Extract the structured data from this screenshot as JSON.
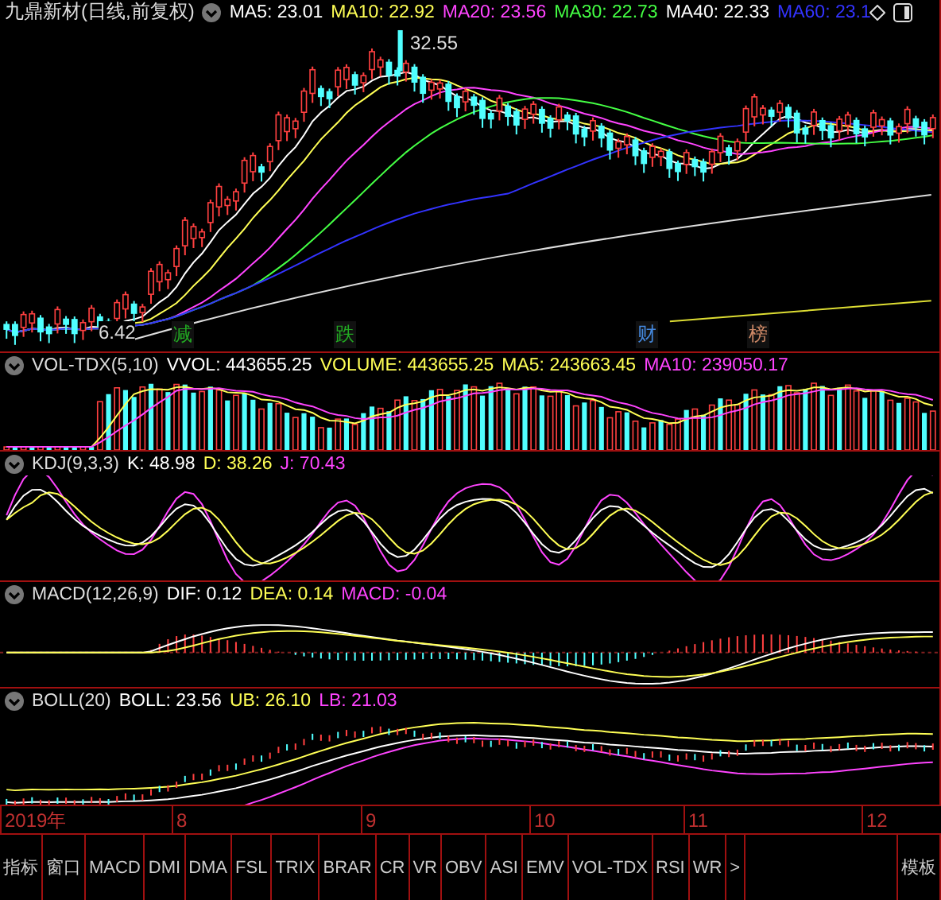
{
  "main_chart": {
    "title": "九鼎新材(日线,前复权)",
    "indicators": [
      {
        "text": "MA5: 23.01",
        "color": "#ffffff"
      },
      {
        "text": "MA10: 22.92",
        "color": "#ffff55"
      },
      {
        "text": "MA20: 23.56",
        "color": "#ff44ff"
      },
      {
        "text": "MA30: 22.73",
        "color": "#44ff44"
      },
      {
        "text": "MA40: 22.33",
        "color": "#ffffff"
      },
      {
        "text": "MA60: 23.1",
        "color": "#3333ff"
      }
    ],
    "high_label": "32.55",
    "low_label": "6.42",
    "markers": [
      {
        "text": "减",
        "color": "#22aa22"
      },
      {
        "text": "跌",
        "color": "#22aa22"
      },
      {
        "text": "财",
        "color": "#4488dd"
      },
      {
        "text": "榜",
        "color": "#cc8866"
      }
    ]
  },
  "panes": [
    {
      "kind": "volume",
      "title": "VOL-TDX(5,10)",
      "values": [
        {
          "text": "VVOL: 443655.25",
          "color": "#ffffff"
        },
        {
          "text": "VOLUME: 443655.25",
          "color": "#ffff55"
        },
        {
          "text": "MA5: 243663.45",
          "color": "#ffff55"
        },
        {
          "text": "MA10: 239050.17",
          "color": "#ff44ff"
        }
      ]
    },
    {
      "kind": "kdj",
      "title": "KDJ(9,3,3)",
      "values": [
        {
          "text": "K: 48.98",
          "color": "#ffffff"
        },
        {
          "text": "D: 38.26",
          "color": "#ffff55"
        },
        {
          "text": "J: 70.43",
          "color": "#ff44ff"
        }
      ]
    },
    {
      "kind": "macd",
      "title": "MACD(12,26,9)",
      "values": [
        {
          "text": "DIF: 0.12",
          "color": "#ffffff"
        },
        {
          "text": "DEA: 0.14",
          "color": "#ffff55"
        },
        {
          "text": "MACD: -0.04",
          "color": "#ff44ff"
        }
      ]
    },
    {
      "kind": "boll",
      "title": "BOLL(20)",
      "values": [
        {
          "text": "BOLL: 23.56",
          "color": "#ffffff"
        },
        {
          "text": "UB: 26.10",
          "color": "#ffff55"
        },
        {
          "text": "LB: 21.03",
          "color": "#ff44ff"
        }
      ]
    }
  ],
  "time_axis": [
    "2019年",
    "8",
    "9",
    "10",
    "11",
    "12"
  ],
  "tabs": [
    {
      "label": "指标",
      "selected": false
    },
    {
      "label": "窗口",
      "selected": false
    },
    {
      "label": "MACD",
      "selected": false
    },
    {
      "label": "DMI",
      "selected": false
    },
    {
      "label": "DMA",
      "selected": false
    },
    {
      "label": "FSL",
      "selected": false
    },
    {
      "label": "TRIX",
      "selected": false
    },
    {
      "label": "BRAR",
      "selected": false
    },
    {
      "label": "CR",
      "selected": false
    },
    {
      "label": "VR",
      "selected": false
    },
    {
      "label": "OBV",
      "selected": false
    },
    {
      "label": "ASI",
      "selected": false
    },
    {
      "label": "EMV",
      "selected": false
    },
    {
      "label": "VOL-TDX",
      "selected": false
    },
    {
      "label": "RSI",
      "selected": false
    },
    {
      "label": "WR",
      "selected": false
    },
    {
      "label": ">",
      "selected": false
    }
  ],
  "template_button": "模板"
}
